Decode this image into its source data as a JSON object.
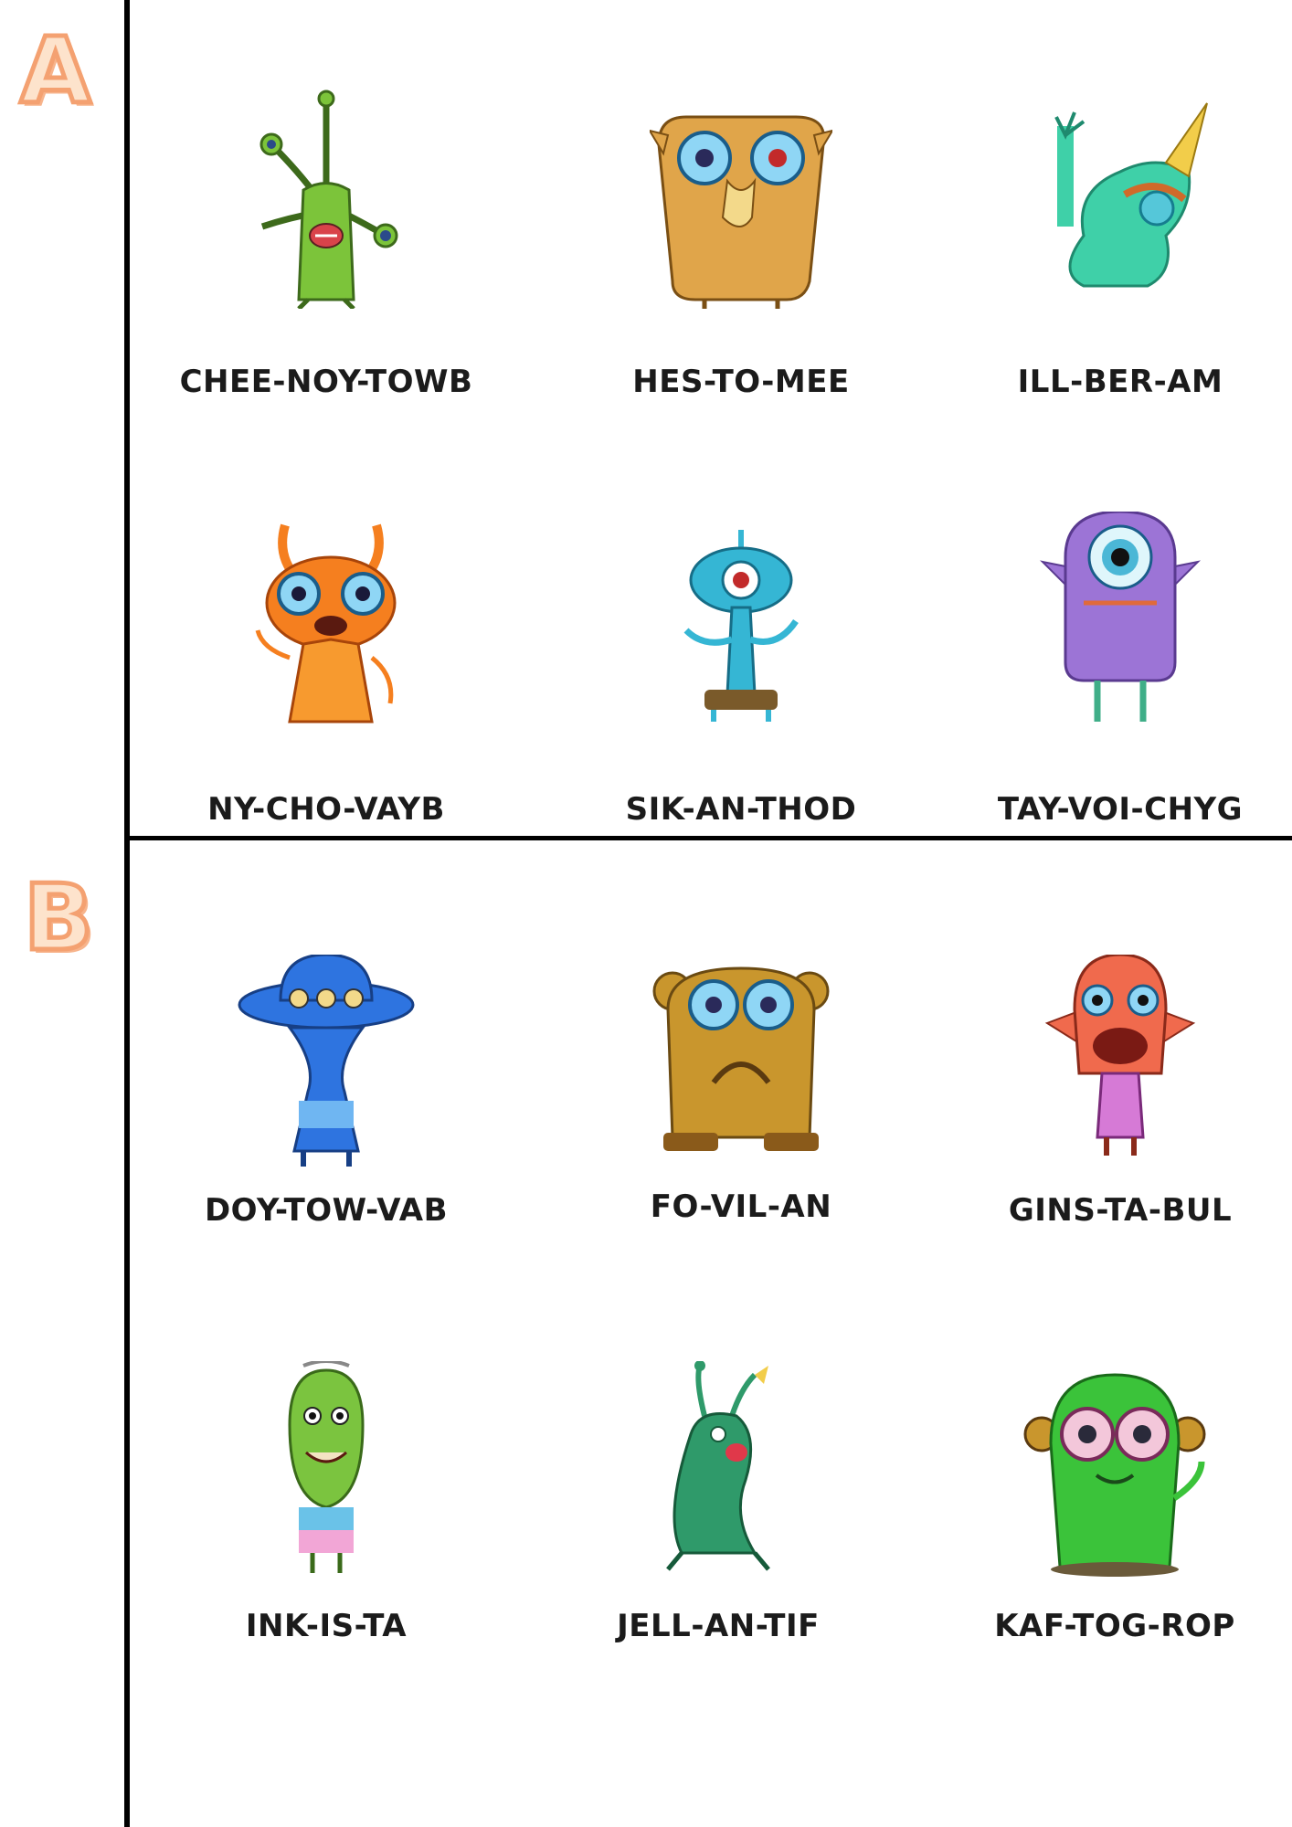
{
  "sections": [
    {
      "letter": "A",
      "creatures": [
        {
          "name": "CHEE-NOY-TOWB",
          "icon": "green-multi-eyed-alien-icon",
          "color": "#7cc43a"
        },
        {
          "name": "HES-TO-MEE",
          "icon": "tan-square-alien-icon",
          "color": "#e0a54a"
        },
        {
          "name": "ILL-BER-AM",
          "icon": "teal-crouching-alien-icon",
          "color": "#3fd0a8"
        },
        {
          "name": "NY-CHO-VAYB",
          "icon": "orange-antenna-alien-icon",
          "color": "#f57f1f"
        },
        {
          "name": "SIK-AN-THOD",
          "icon": "blue-cyclops-alien-icon",
          "color": "#35b6d4"
        },
        {
          "name": "TAY-VOI-CHYG",
          "icon": "purple-cyclops-alien-icon",
          "color": "#9c74d6"
        }
      ]
    },
    {
      "letter": "B",
      "creatures": [
        {
          "name": "DOY-TOW-VAB",
          "icon": "blue-hat-alien-icon",
          "color": "#2e74e0"
        },
        {
          "name": "FO-VIL-AN",
          "icon": "golden-frowning-alien-icon",
          "color": "#c9962d"
        },
        {
          "name": "GINS-TA-BUL",
          "icon": "red-pink-alien-icon",
          "color": "#f06a4d"
        },
        {
          "name": "INK-IS-TA",
          "icon": "green-bean-alien-icon",
          "color": "#7bc43f"
        },
        {
          "name": "JELL-AN-TIF",
          "icon": "green-slug-alien-icon",
          "color": "#2f9a6a"
        },
        {
          "name": "KAF-TOG-ROP",
          "icon": "green-big-eyed-alien-icon",
          "color": "#3bc33a"
        }
      ]
    }
  ]
}
